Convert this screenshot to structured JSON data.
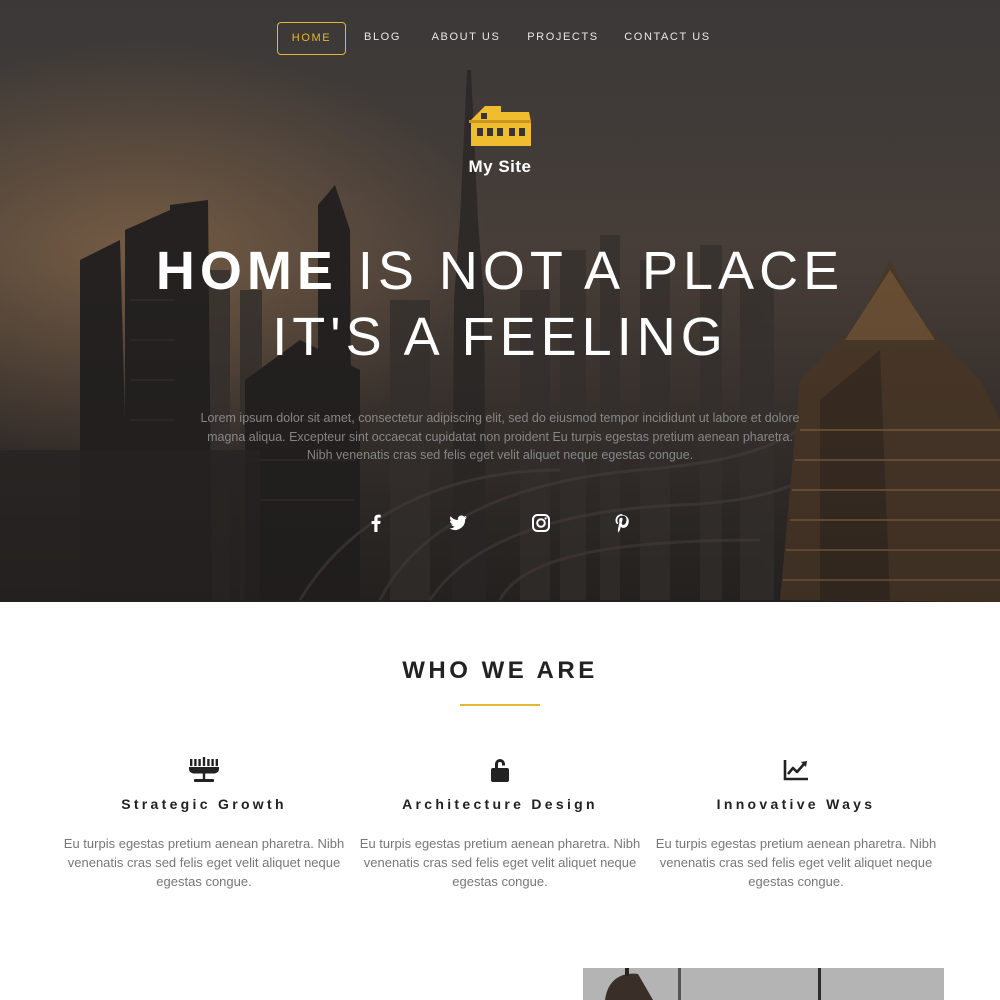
{
  "nav": {
    "items": [
      {
        "label": "HOME",
        "active": true
      },
      {
        "label": "BLOG",
        "active": false
      },
      {
        "label": "ABOUT US",
        "active": false
      },
      {
        "label": "PROJECTS",
        "active": false
      },
      {
        "label": "CONTACT US",
        "active": false
      }
    ]
  },
  "brand": {
    "logo_icon": "house-icon",
    "name": "My Site"
  },
  "hero": {
    "headline_line1_bold": "HOME",
    "headline_line1_rest": " IS NOT A PLACE",
    "headline_line2": "IT'S A FEELING",
    "body": "Lorem ipsum dolor sit amet, consectetur adipiscing elit, sed do eiusmod tempor incididunt ut labore et dolore magna aliqua. Excepteur sint occaecat cupidatat non proident Eu turpis egestas pretium aenean pharetra. Nibh venenatis cras sed felis eget velit aliquet neque egestas congue.",
    "socials": [
      "facebook-icon",
      "twitter-icon",
      "instagram-icon",
      "pinterest-icon"
    ]
  },
  "who_we_are": {
    "title": "WHO WE ARE",
    "features": [
      {
        "icon": "menorah-icon",
        "title": "Strategic Growth",
        "text": "Eu turpis egestas pretium aenean pharetra. Nibh venenatis cras sed felis eget velit aliquet neque egestas congue."
      },
      {
        "icon": "unlock-icon",
        "title": "Architecture Design",
        "text": "Eu turpis egestas pretium aenean pharetra. Nibh venenatis cras sed felis eget velit aliquet neque egestas congue."
      },
      {
        "icon": "chart-line-icon",
        "title": "Innovative Ways",
        "text": "Eu turpis egestas pretium aenean pharetra. Nibh venenatis cras sed felis eget velit aliquet neque egestas congue."
      }
    ]
  },
  "colors": {
    "accent": "#e6b534",
    "hero_text": "#ffffff",
    "heading": "#222222",
    "body_text": "#777777"
  }
}
